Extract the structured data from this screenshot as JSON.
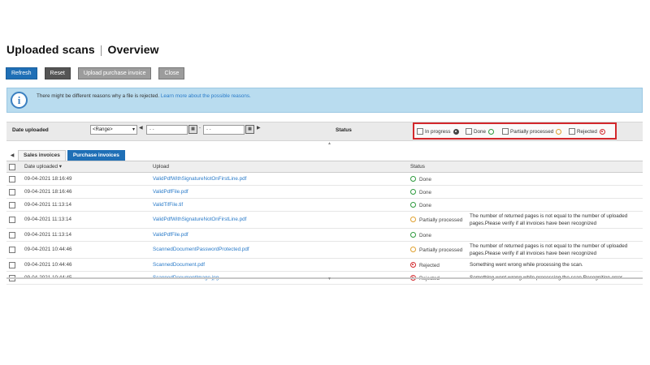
{
  "page": {
    "title": "Uploaded scans",
    "title_sep": "|",
    "title_sub": "Overview"
  },
  "toolbar": {
    "refresh": "Refresh",
    "reset": "Reset",
    "upload": "Upload purchase invoice",
    "close": "Close"
  },
  "info": {
    "text": "There might be different reasons why a file is rejected.",
    "link": "Learn more about the possible reasons."
  },
  "filter": {
    "date_label": "Date uploaded",
    "range": "<Range>",
    "from": "- -",
    "to": "- -",
    "dash": "-",
    "status_label": "Status",
    "options": {
      "in_progress": "In progress",
      "done": "Done",
      "partial": "Partially processed",
      "rejected": "Rejected"
    }
  },
  "tabs": {
    "sales": "Sales invoices",
    "purchase": "Purchase invoices"
  },
  "table": {
    "headers": {
      "date": "Date uploaded",
      "upload": "Upload",
      "status": "Status"
    },
    "rows": [
      {
        "date": "09-04-2021 18:16:49",
        "file": "ValidPdfWithSignatureNotOnFirstLine.pdf",
        "status": "Done",
        "type": "done",
        "msg": ""
      },
      {
        "date": "09-04-2021 18:16:46",
        "file": "ValidPdfFile.pdf",
        "status": "Done",
        "type": "done",
        "msg": ""
      },
      {
        "date": "09-04-2021 11:13:14",
        "file": "ValidTifFile.tif",
        "status": "Done",
        "type": "done",
        "msg": ""
      },
      {
        "date": "09-04-2021 11:13:14",
        "file": "ValidPdfWithSignatureNotOnFirstLine.pdf",
        "status": "Partially processed",
        "type": "partial",
        "msg": "The number of returned pages is not equal to the number of uploaded pages.Please verify if all invoices have been recognized"
      },
      {
        "date": "09-04-2021 11:13:14",
        "file": "ValidPdfFile.pdf",
        "status": "Done",
        "type": "done",
        "msg": ""
      },
      {
        "date": "09-04-2021 10:44:46",
        "file": "ScannedDocumentPasswordProtected.pdf",
        "status": "Partially processed",
        "type": "partial",
        "msg": "The number of returned pages is not equal to the number of uploaded pages.Please verify if all invoices have been recognized"
      },
      {
        "date": "09-04-2021 10:44:46",
        "file": "ScannedDocument.pdf",
        "status": "Rejected",
        "type": "rejected",
        "msg": "Something went wrong while processing the scan."
      },
      {
        "date": "09-04-2021 10:44:45",
        "file": "ScannedDocumentImage.jpg",
        "status": "Rejected",
        "type": "rejected",
        "msg": "Something went wrong while processing the scan.Recognition error."
      }
    ]
  },
  "colors": {
    "primary": "#1f6fb6",
    "info_bg": "#b9dcef",
    "done": "#2e9b3e",
    "partial": "#e0a12f",
    "rejected": "#d3282c",
    "link": "#2a7bc9"
  }
}
